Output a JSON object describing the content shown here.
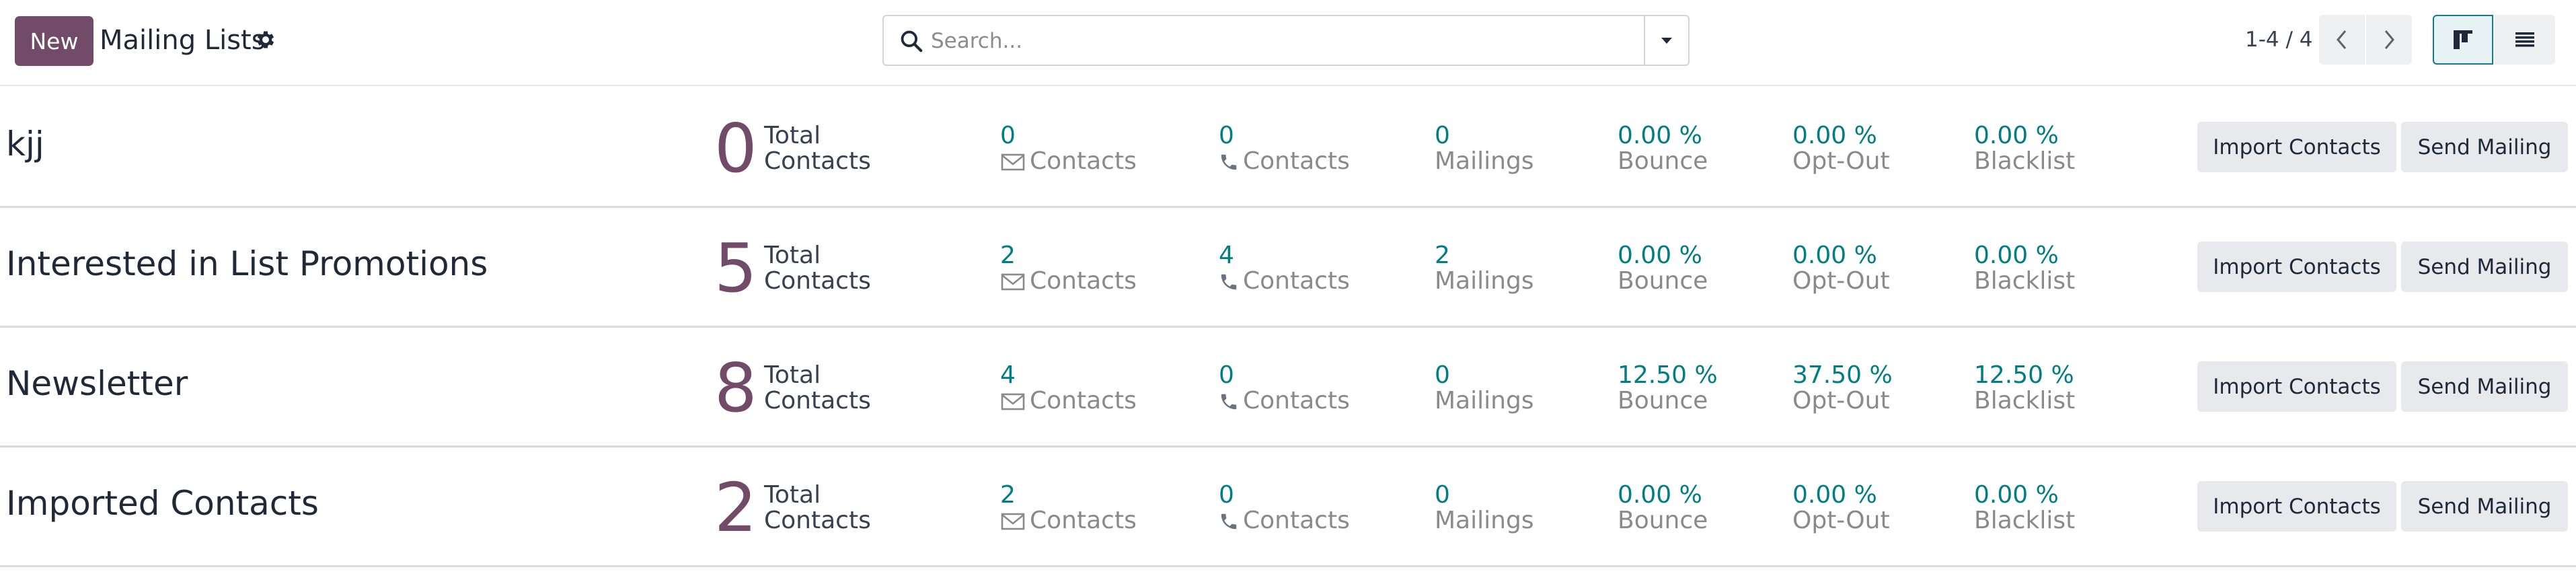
{
  "header": {
    "new_label": "New",
    "title": "Mailing Lists",
    "search_placeholder": "Search...",
    "pager": "1-4 / 4"
  },
  "lists": [
    {
      "name": "kjj",
      "total": "0",
      "total_label": [
        "Total",
        "Contacts"
      ],
      "email_count": "0",
      "email_label": "Contacts",
      "phone_count": "0",
      "phone_label": "Contacts",
      "mailings": "0",
      "mailings_label": "Mailings",
      "bounce": "0.00 %",
      "bounce_label": "Bounce",
      "optout": "0.00 %",
      "optout_label": "Opt-Out",
      "blacklist": "0.00 %",
      "blacklist_label": "Blacklist",
      "import_label": "Import Contacts",
      "send_label": "Send Mailing"
    },
    {
      "name": "Interested in List Promotions",
      "total": "5",
      "total_label": [
        "Total",
        "Contacts"
      ],
      "email_count": "2",
      "email_label": "Contacts",
      "phone_count": "4",
      "phone_label": "Contacts",
      "mailings": "2",
      "mailings_label": "Mailings",
      "bounce": "0.00 %",
      "bounce_label": "Bounce",
      "optout": "0.00 %",
      "optout_label": "Opt-Out",
      "blacklist": "0.00 %",
      "blacklist_label": "Blacklist",
      "import_label": "Import Contacts",
      "send_label": "Send Mailing"
    },
    {
      "name": "Newsletter",
      "total": "8",
      "total_label": [
        "Total",
        "Contacts"
      ],
      "email_count": "4",
      "email_label": "Contacts",
      "phone_count": "0",
      "phone_label": "Contacts",
      "mailings": "0",
      "mailings_label": "Mailings",
      "bounce": "12.50 %",
      "bounce_label": "Bounce",
      "optout": "37.50 %",
      "optout_label": "Opt-Out",
      "blacklist": "12.50 %",
      "blacklist_label": "Blacklist",
      "import_label": "Import Contacts",
      "send_label": "Send Mailing"
    },
    {
      "name": "Imported Contacts",
      "total": "2",
      "total_label": [
        "Total",
        "Contacts"
      ],
      "email_count": "2",
      "email_label": "Contacts",
      "phone_count": "0",
      "phone_label": "Contacts",
      "mailings": "0",
      "mailings_label": "Mailings",
      "bounce": "0.00 %",
      "bounce_label": "Bounce",
      "optout": "0.00 %",
      "optout_label": "Opt-Out",
      "blacklist": "0.00 %",
      "blacklist_label": "Blacklist",
      "import_label": "Import Contacts",
      "send_label": "Send Mailing"
    }
  ],
  "icons": {
    "settings": "gear-icon",
    "search": "search-icon",
    "search_options": "caret-down-icon",
    "prev": "chevron-left-icon",
    "next": "chevron-right-icon",
    "kanban_view": "kanban-view-icon",
    "list_view": "list-view-icon",
    "email": "envelope-icon",
    "phone": "phone-icon"
  },
  "colors": {
    "brand": "#714b67",
    "accent": "#017e84",
    "muted": "#8a8a8a"
  }
}
